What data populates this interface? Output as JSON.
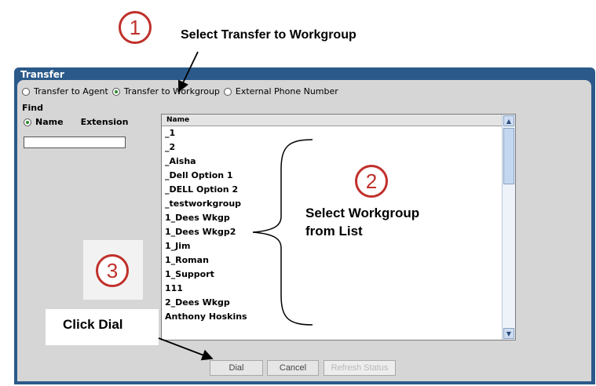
{
  "annotations": {
    "step1_number": "1",
    "step1_text": "Select Transfer to Workgroup",
    "step2_number": "2",
    "step2_text_line1": "Select Workgroup",
    "step2_text_line2": "from List",
    "step3_number": "3",
    "step3_text": "Click Dial"
  },
  "dialog": {
    "title": "Transfer",
    "transfer_options": [
      {
        "label": "Transfer to Agent",
        "selected": false
      },
      {
        "label": "Transfer to Workgroup",
        "selected": true
      },
      {
        "label": "External Phone Number",
        "selected": false
      }
    ],
    "find_label": "Find",
    "find_by": [
      {
        "label": "Name",
        "selected": true
      },
      {
        "label": "Extension",
        "selected": false
      }
    ],
    "search_value": "",
    "list_header": "Name",
    "workgroups": [
      "_1",
      "_2",
      "_Aisha",
      "_Dell Option 1",
      "_DELL Option 2",
      "_testworkgroup",
      "1_Dees Wkgp",
      "1_Dees Wkgp2",
      "1_Jim",
      "1_Roman",
      "1_Support",
      "111",
      "2_Dees Wkgp",
      "Anthony Hoskins"
    ],
    "buttons": {
      "dial": "Dial",
      "cancel": "Cancel",
      "refresh": "Refresh Status"
    }
  },
  "colors": {
    "title_bar": "#2b5a8a",
    "callout_red": "#c0302b",
    "panel": "#d6d6d6"
  }
}
